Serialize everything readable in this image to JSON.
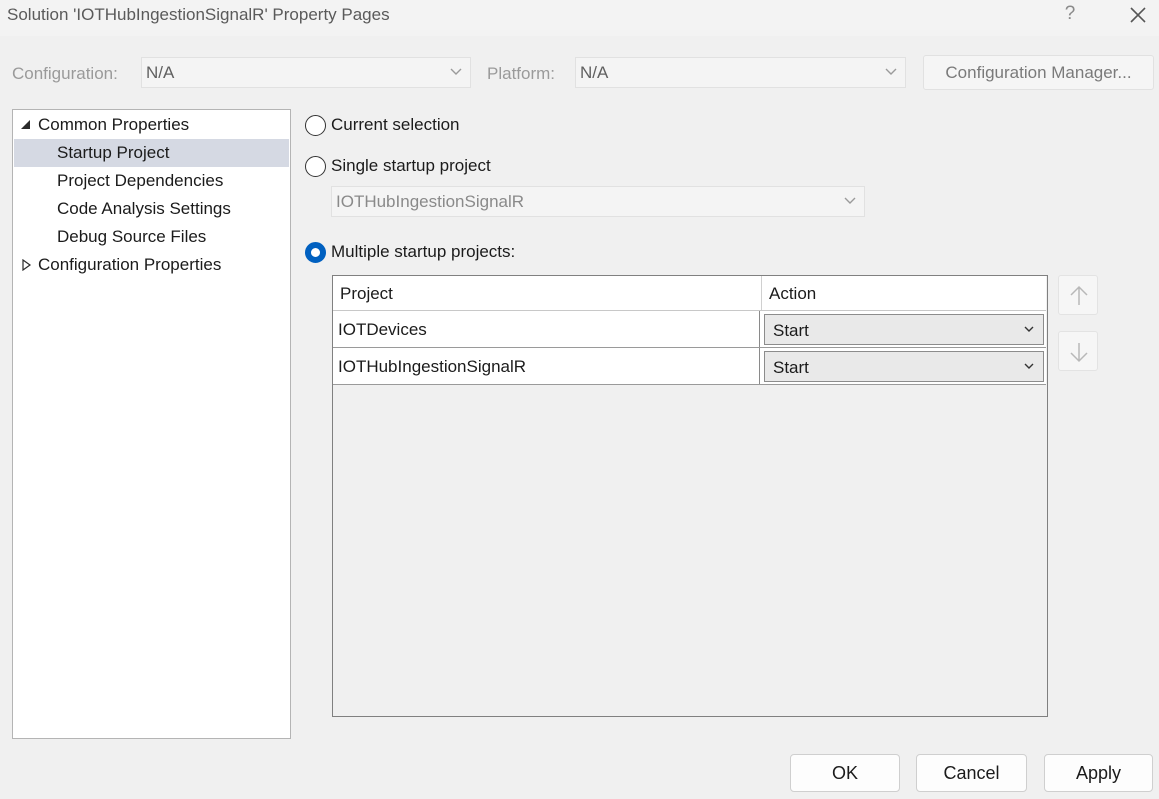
{
  "window": {
    "title": "Solution 'IOTHubIngestionSignalR' Property Pages",
    "help_glyph": "?",
    "close_icon": "close-icon"
  },
  "toolbar": {
    "configuration_label": "Configuration:",
    "configuration_value": "N/A",
    "platform_label": "Platform:",
    "platform_value": "N/A",
    "config_manager_label": "Configuration Manager..."
  },
  "tree": {
    "items": [
      {
        "label": "Common Properties",
        "expanded": true
      },
      {
        "label": "Startup Project",
        "selected": true
      },
      {
        "label": "Project Dependencies"
      },
      {
        "label": "Code Analysis Settings"
      },
      {
        "label": "Debug Source Files"
      },
      {
        "label": "Configuration Properties",
        "expanded": false
      }
    ]
  },
  "startup": {
    "current_selection_label": "Current selection",
    "single_label": "Single startup project",
    "single_value": "IOTHubIngestionSignalR",
    "multiple_label": "Multiple startup projects:",
    "selected_option": "multiple"
  },
  "grid": {
    "headers": [
      "Project",
      "Action"
    ],
    "rows": [
      {
        "project": "IOTDevices",
        "action": "Start"
      },
      {
        "project": "IOTHubIngestionSignalR",
        "action": "Start"
      }
    ]
  },
  "buttons": {
    "ok": "OK",
    "cancel": "Cancel",
    "apply": "Apply"
  },
  "colors": {
    "accent": "#0060c0",
    "selection": "#d5d9e3"
  }
}
